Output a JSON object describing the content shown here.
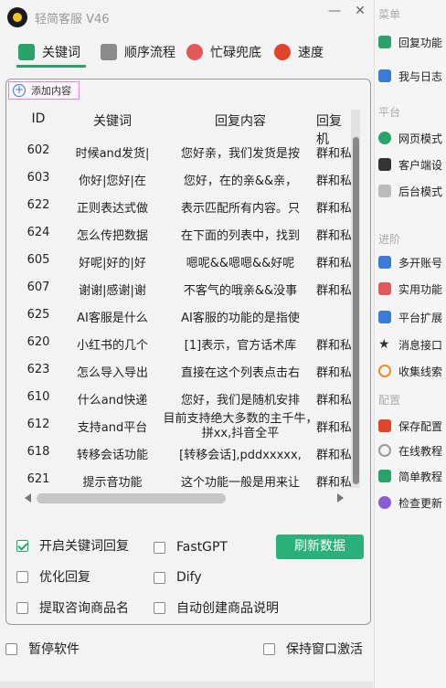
{
  "window": {
    "title": "轻简客服  V46"
  },
  "tabs": [
    {
      "label": "关键词",
      "icon": "keyword-icon",
      "color": "#2aa36b"
    },
    {
      "label": "顺序流程",
      "icon": "flow-icon",
      "color": "#777777"
    },
    {
      "label": "忙碌兜底",
      "icon": "flower-icon",
      "color": "#e05a5a"
    },
    {
      "label": "速度",
      "icon": "speed-icon",
      "color": "#e0452c"
    }
  ],
  "add_button": {
    "label": "添加内容"
  },
  "table": {
    "headers": [
      "ID",
      "关键词",
      "回复内容",
      "回复机"
    ],
    "rows": [
      {
        "id": "602",
        "keyword": "时候and发货|",
        "reply": "您好亲，我们发货是按",
        "type": "群和私"
      },
      {
        "id": "603",
        "keyword": "你好|您好|在",
        "reply": "您好，在的亲&&亲，",
        "type": "群和私"
      },
      {
        "id": "622",
        "keyword": "正则表达式做",
        "reply": "表示匹配所有内容。只",
        "type": "群和私"
      },
      {
        "id": "624",
        "keyword": "怎么传把数据",
        "reply": "在下面的列表中，找到",
        "type": "群和私"
      },
      {
        "id": "605",
        "keyword": "好呢|好的|好",
        "reply": "嗯呢&&嗯嗯&&好呢",
        "type": "群和私"
      },
      {
        "id": "607",
        "keyword": "谢谢|感谢|谢",
        "reply": "不客气的哦亲&&没事",
        "type": "群和私"
      },
      {
        "id": "625",
        "keyword": "AI客服是什么",
        "reply": "AI客服的功能的是指使",
        "type": ""
      },
      {
        "id": "620",
        "keyword": "小红书的几个",
        "reply": "[1]表示，官方话术库",
        "type": "群和私"
      },
      {
        "id": "623",
        "keyword": "怎么导入导出",
        "reply": "直接在这个列表点击右",
        "type": "群和私"
      },
      {
        "id": "610",
        "keyword": "什么and快递",
        "reply": "您好，我们是随机安排",
        "type": "群和私"
      },
      {
        "id": "612",
        "keyword": "支持and平台",
        "reply": "目前支持绝大多数的主千牛，拼xx,抖音全平",
        "type": "群和私"
      },
      {
        "id": "618",
        "keyword": "转移会话功能",
        "reply": "[转移会话],pddxxxxx,",
        "type": "群和私"
      },
      {
        "id": "621",
        "keyword": "提示音功能",
        "reply": "这个功能一般是用来让",
        "type": "群和私"
      }
    ]
  },
  "options": {
    "enable_keyword": {
      "label": "开启关键词回复",
      "checked": true
    },
    "fastgpt": {
      "label": "FastGPT",
      "checked": false
    },
    "optimize_reply": {
      "label": "优化回复",
      "checked": false
    },
    "dify": {
      "label": "Dify",
      "checked": false
    },
    "extract_product": {
      "label": "提取咨询商品名",
      "checked": false
    },
    "auto_create_desc": {
      "label": "自动创建商品说明",
      "checked": false
    }
  },
  "refresh_button": {
    "label": "刷新数据"
  },
  "bottom": {
    "pause": {
      "label": "暂停软件",
      "checked": false
    },
    "keep_active": {
      "label": "保持窗口激活",
      "checked": false
    }
  },
  "sidebar": {
    "groups": [
      {
        "heading": "菜单",
        "items": [
          {
            "label": "回复功能",
            "icon": "reply-icon",
            "color": "#2aa36b"
          },
          {
            "label": "我与日志",
            "icon": "log-icon",
            "color": "#3a7bd5"
          }
        ]
      },
      {
        "heading": "平台",
        "items": [
          {
            "label": "网页模式",
            "icon": "web-icon",
            "color": "#2aa36b"
          },
          {
            "label": "客户端设",
            "icon": "client-icon",
            "color": "#333333"
          },
          {
            "label": "后台模式",
            "icon": "background-icon",
            "color": "#888888"
          }
        ]
      },
      {
        "heading": "进阶",
        "items": [
          {
            "label": "多开账号",
            "icon": "multi-account-icon",
            "color": "#3a7bd5"
          },
          {
            "label": "实用功能",
            "icon": "tools-icon",
            "color": "#e05a5a"
          },
          {
            "label": "平台扩展",
            "icon": "extend-icon",
            "color": "#3a7bd5"
          },
          {
            "label": "消息接口",
            "icon": "star-icon",
            "color": "#333333"
          },
          {
            "label": "收集线索",
            "icon": "search-icon",
            "color": "#f08a24"
          }
        ]
      },
      {
        "heading": "配置",
        "items": [
          {
            "label": "保存配置",
            "icon": "save-icon",
            "color": "#e0452c"
          },
          {
            "label": "在线教程",
            "icon": "globe-icon",
            "color": "#777777"
          },
          {
            "label": "简单教程",
            "icon": "tutorial-icon",
            "color": "#2aa36b"
          },
          {
            "label": "检查更新",
            "icon": "update-icon",
            "color": "#8a5bd6"
          }
        ]
      }
    ]
  }
}
